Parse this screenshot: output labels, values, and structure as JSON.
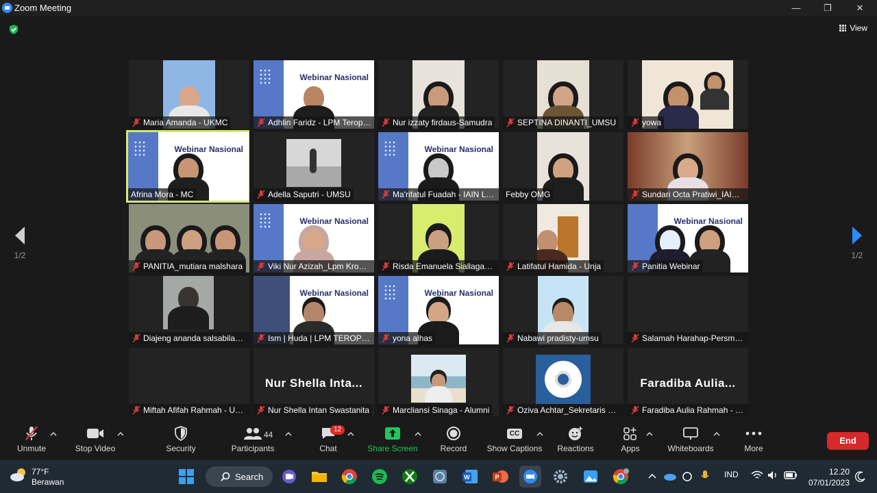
{
  "window": {
    "title": "Zoom Meeting",
    "minimize": "—",
    "restore": "❐",
    "close": "✕"
  },
  "view": {
    "label": "View"
  },
  "paging": {
    "left": "1/2",
    "right": "1/2"
  },
  "participants": [
    {
      "name": "Maria Amanda - UKMC",
      "muted": true
    },
    {
      "name": "Adhlin Faridz - LPM Teropong UMSU",
      "muted": true
    },
    {
      "name": "Nur izzaty firdaus-Samudra",
      "muted": true
    },
    {
      "name": "SEPTINA DINANTI_UMSU",
      "muted": true
    },
    {
      "name": "yowa",
      "muted": true
    },
    {
      "name": "Afrina Mora - MC",
      "muted": false,
      "active": true
    },
    {
      "name": "Adella Saputri - UMSU",
      "muted": true
    },
    {
      "name": "Ma'rifatul Fuadah - IAIN Langsa",
      "muted": true
    },
    {
      "name": "Febby OMG",
      "muted": false
    },
    {
      "name": "Sundari Octa Pratiwi_IAIN Langsa",
      "muted": true
    },
    {
      "name": "PANITIA_mutiara malshara",
      "muted": true
    },
    {
      "name": "Viki Nur Azizah_Lpm Kronika",
      "muted": true
    },
    {
      "name": "Risda Emanuela Siallagan_UMSU",
      "muted": true
    },
    {
      "name": "Latifatul Hamida - Unja",
      "muted": true
    },
    {
      "name": "Panitia Webinar",
      "muted": true
    },
    {
      "name": "Diajeng ananda salsabila_UMSU",
      "muted": true
    },
    {
      "name": "Ism | Huda | LPM TEROPONG",
      "muted": true
    },
    {
      "name": "yona alhas",
      "muted": true
    },
    {
      "name": "Nabawi pradisty-umsu",
      "muted": true
    },
    {
      "name": "Salamah Harahap-Persma UMSU",
      "muted": true
    },
    {
      "name": "Miftah Afifah Rahmah - UMSU",
      "muted": true
    },
    {
      "name": "Nur Shella Intan Swastanita",
      "muted": true,
      "display": "Nur Shella Inta..."
    },
    {
      "name": "Marcliansi Sinaga - Alumni",
      "muted": true
    },
    {
      "name": "Oziva Achtar_Sekretaris Persma",
      "muted": true
    },
    {
      "name": "Faradiba Aulia Rahmah - UMSU",
      "muted": true,
      "display": "Faradiba Aulia..."
    }
  ],
  "toolbar": {
    "unmute": "Unmute",
    "stop_video": "Stop Video",
    "security": "Security",
    "participants": "Participants",
    "participants_count": "44",
    "chat": "Chat",
    "chat_badge": "12",
    "share_screen": "Share Screen",
    "record": "Record",
    "show_captions": "Show Captions",
    "captions_icon": "CC",
    "reactions": "Reactions",
    "apps": "Apps",
    "whiteboards": "Whiteboards",
    "more": "More",
    "end": "End",
    "share_color": "#22c55e"
  },
  "taskbar": {
    "weather_temp": "77°F",
    "weather_desc": "Berawan",
    "search": "Search",
    "lang": "IND",
    "time": "12.20",
    "date": "07/01/2023"
  }
}
